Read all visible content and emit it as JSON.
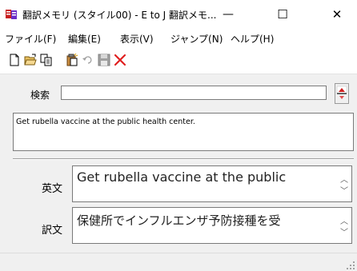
{
  "window": {
    "title": "翻訳メモリ (スタイル00) - E to J 翻訳メモ...",
    "minimize_glyph": "—",
    "maximize_glyph": "☐",
    "close_glyph": "✕"
  },
  "menu": {
    "items": [
      {
        "label": "ファイル(F)"
      },
      {
        "label": "編集(E)"
      },
      {
        "label": "表示(V)"
      },
      {
        "label": "ジャンプ(N)"
      },
      {
        "label": "ヘルプ(H)"
      }
    ]
  },
  "toolbar": {
    "icons": [
      "new-document-icon",
      "open-folder-icon",
      "copy-icon",
      "paste-icon",
      "undo-icon",
      "save-icon",
      "delete-icon"
    ],
    "accent_red": "#e02020"
  },
  "search": {
    "label": "検索",
    "value": ""
  },
  "result": {
    "text": "Get rubella vaccine at the public health center."
  },
  "fields": {
    "english_label": "英文",
    "english_value": "Get rubella vaccine at the public",
    "translation_label": "訳文",
    "translation_value": "保健所でインフルエンザ予防接種を受"
  }
}
